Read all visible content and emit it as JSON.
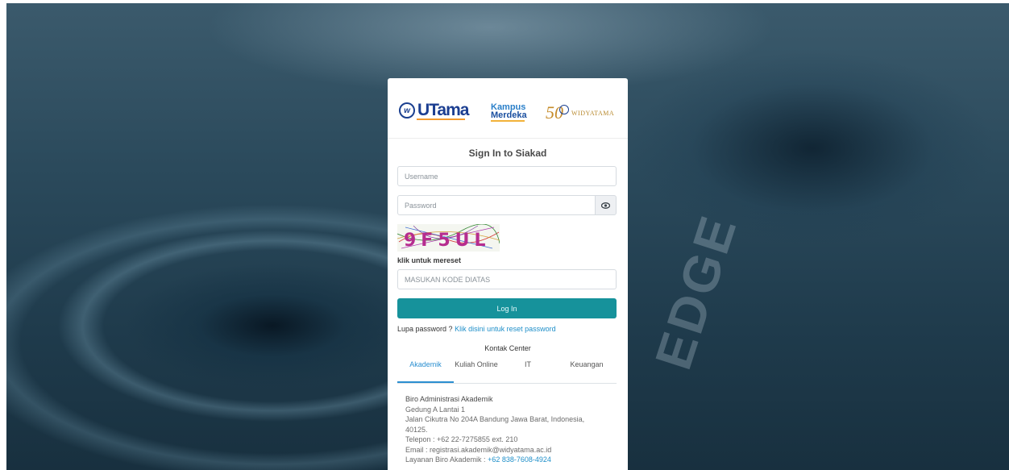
{
  "logos": {
    "utama_mark": "w",
    "utama_text": "UTama",
    "kampus_line1": "Kampus",
    "kampus_line2": "Merdeka",
    "widyatama_number": "50",
    "widyatama_text": "WIDYATAMA"
  },
  "form": {
    "title": "Sign In to Siakad",
    "username_placeholder": "Username",
    "password_placeholder": "Password",
    "captcha_text": "9F5UL",
    "captcha_reset_label": "klik untuk mereset",
    "captcha_input_placeholder": "MASUKAN KODE DIATAS",
    "login_label": "Log In",
    "forgot_text": "Lupa password ?",
    "forgot_link": "Klik disini untuk reset password"
  },
  "contact": {
    "heading": "Kontak Center",
    "tabs": [
      {
        "label": "Akademik",
        "active": true
      },
      {
        "label": "Kuliah Online",
        "active": false
      },
      {
        "label": "IT",
        "active": false
      },
      {
        "label": "Keuangan",
        "active": false
      }
    ],
    "details": {
      "name": "Biro Administrasi Akademik",
      "building": "Gedung A Lantai 1",
      "address": "Jalan Cikutra No 204A Bandung Jawa Barat, Indonesia, 40125.",
      "phone": "Telepon : +62 22-7275855 ext. 210",
      "email": "Email : registrasi.akademik@widyatama.ac.id",
      "service_label": "Layanan Biro Akademik :",
      "service_number": "+62 838-7608-4924"
    }
  },
  "background": {
    "watermark": "EDGE"
  },
  "colors": {
    "primary_button": "#16929b",
    "link": "#1f8fc9",
    "active_tab": "#2b8fd0"
  }
}
